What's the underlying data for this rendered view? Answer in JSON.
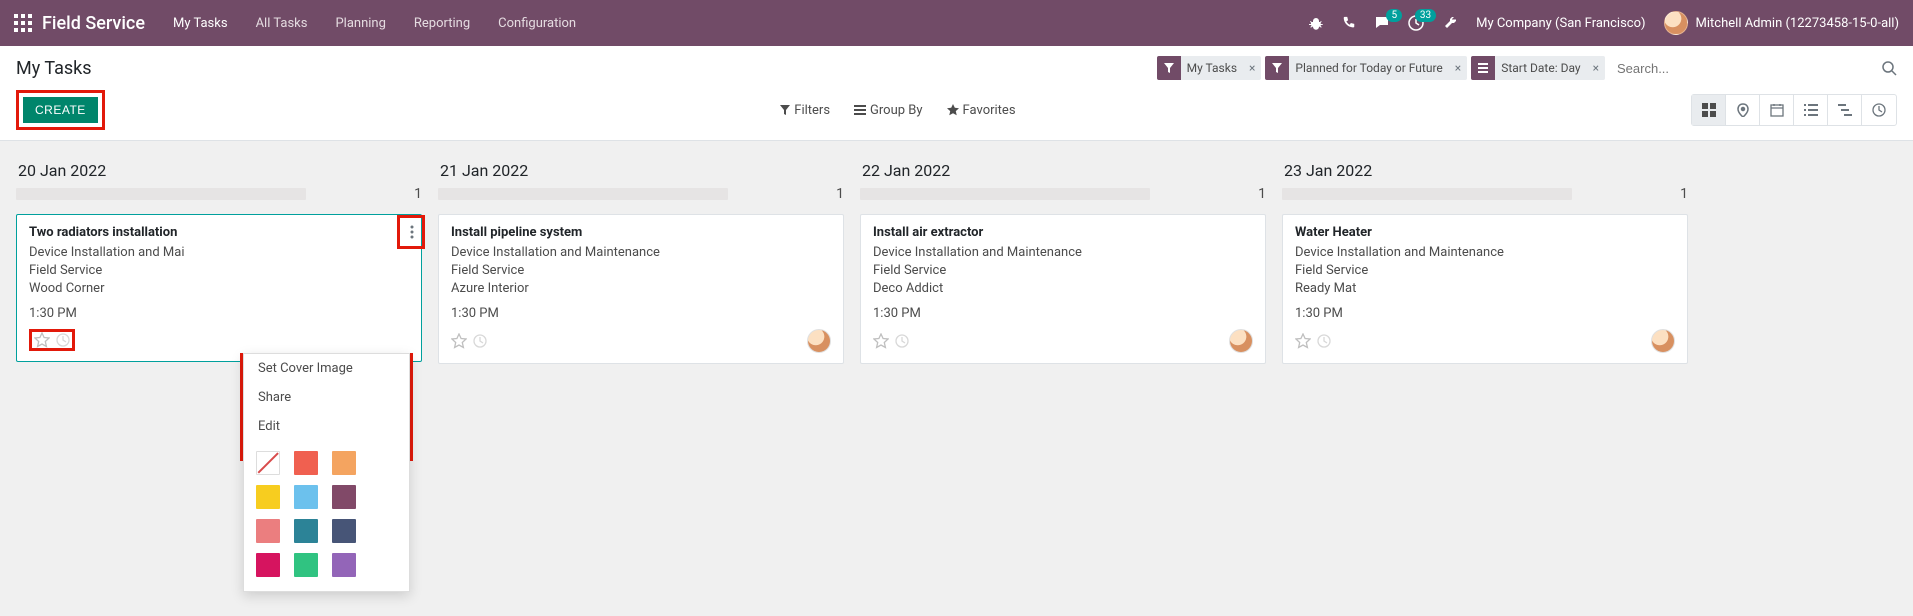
{
  "header": {
    "brand": "Field Service",
    "nav": [
      "My Tasks",
      "All Tasks",
      "Planning",
      "Reporting",
      "Configuration"
    ],
    "msg_count": "5",
    "activity_count": "33",
    "company": "My Company (San Francisco)",
    "user": "Mitchell Admin (12273458-15-0-all)"
  },
  "control": {
    "title": "My Tasks",
    "create": "CREATE",
    "facets": [
      {
        "label": "My Tasks",
        "type": "filter"
      },
      {
        "label": "Planned for Today or Future",
        "type": "filter"
      },
      {
        "label": "Start Date: Day",
        "type": "group"
      }
    ],
    "search_placeholder": "Search...",
    "tools": {
      "filters": "Filters",
      "groupby": "Group By",
      "favorites": "Favorites"
    }
  },
  "kanban": {
    "columns": [
      {
        "title": "20 Jan 2022",
        "count": "1",
        "card": {
          "title": "Two radiators installation",
          "l1": "Device Installation and Mai",
          "l2": "Field Service",
          "l3": "Wood Corner",
          "time": "1:30 PM"
        }
      },
      {
        "title": "21 Jan 2022",
        "count": "1",
        "card": {
          "title": "Install pipeline system",
          "l1": "Device Installation and Maintenance",
          "l2": "Field Service",
          "l3": "Azure Interior",
          "time": "1:30 PM"
        }
      },
      {
        "title": "22 Jan 2022",
        "count": "1",
        "card": {
          "title": "Install air extractor",
          "l1": "Device Installation and Maintenance",
          "l2": "Field Service",
          "l3": "Deco Addict",
          "time": "1:30 PM"
        }
      },
      {
        "title": "23 Jan 2022",
        "count": "1",
        "card": {
          "title": "Water Heater",
          "l1": "Device Installation and Maintenance",
          "l2": "Field Service",
          "l3": "Ready Mat",
          "time": "1:30 PM"
        }
      }
    ]
  },
  "dropdown": {
    "items": [
      "Set Cover Image",
      "Share",
      "Edit"
    ],
    "colors": [
      "#f06050",
      "#f4a460",
      "#f7cd1f",
      "#6cc1ed",
      "#814968",
      "#eb7e7f",
      "#2c8397",
      "#475577",
      "#d6145f",
      "#30c381",
      "#9365b8"
    ]
  }
}
